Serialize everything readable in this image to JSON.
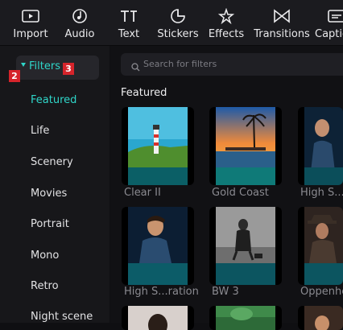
{
  "toolbar": {
    "items": [
      {
        "label": "Import",
        "icon": "import-icon"
      },
      {
        "label": "Audio",
        "icon": "audio-icon"
      },
      {
        "label": "Text",
        "icon": "text-icon"
      },
      {
        "label": "Stickers",
        "icon": "stickers-icon"
      },
      {
        "label": "Effects",
        "icon": "effects-icon"
      },
      {
        "label": "Transitions",
        "icon": "transitions-icon"
      },
      {
        "label": "Captio",
        "icon": "captions-icon"
      }
    ]
  },
  "sidebar": {
    "header": "Filters",
    "badges": [
      "2",
      "3"
    ],
    "categories": [
      "Featured",
      "Life",
      "Scenery",
      "Movies",
      "Portrait",
      "Mono",
      "Retro",
      "Night scene"
    ],
    "active": "Featured"
  },
  "main": {
    "search_placeholder": "Search for filters",
    "section_title": "Featured",
    "filters": [
      {
        "name": "Clear II"
      },
      {
        "name": "Gold Coast"
      },
      {
        "name": "High S..."
      },
      {
        "name": "High S...ration"
      },
      {
        "name": "BW 3"
      },
      {
        "name": "Oppenhe"
      }
    ]
  },
  "colors": {
    "accent": "#2fd6c9",
    "badge": "#d6242b",
    "background": "#0f0f12"
  }
}
